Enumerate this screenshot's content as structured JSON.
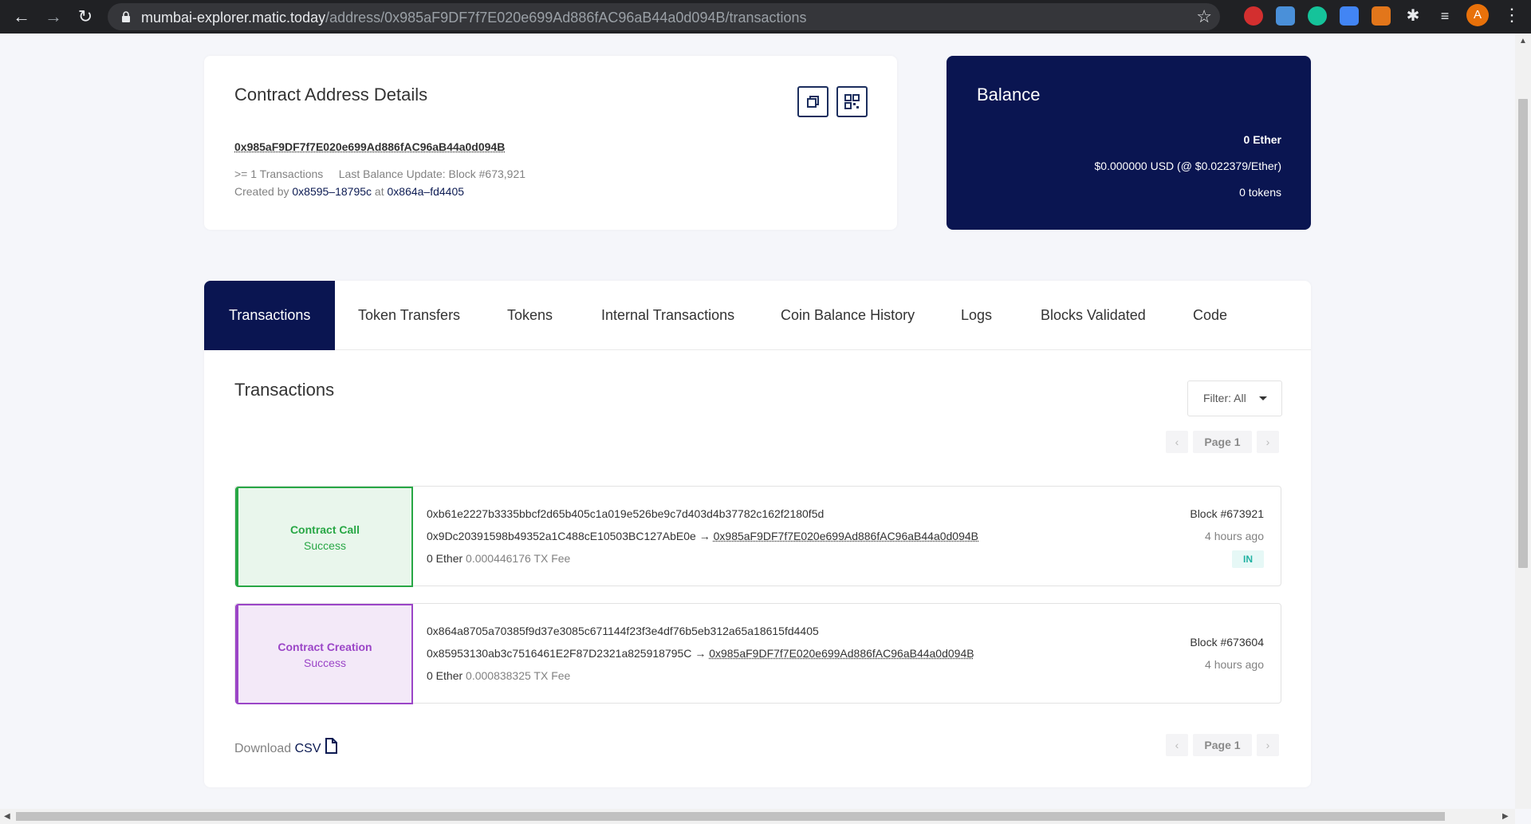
{
  "browser": {
    "url_host": "mumbai-explorer.matic.today",
    "url_path": "/address/0x985aF9DF7f7E020e699Ad886fAC96aB44a0d094B/transactions",
    "profile_initial": "A"
  },
  "details": {
    "title": "Contract Address Details",
    "address": "0x985aF9DF7f7E020e699Ad886fAC96aB44a0d094B",
    "tx_count": ">= 1 Transactions",
    "last_balance": "Last Balance Update: Block #673,921",
    "created_by_label": "Created by",
    "creator": "0x8595–18795c",
    "at_label": "at",
    "creation_tx": "0x864a–fd4405"
  },
  "balance": {
    "title": "Balance",
    "ether": "0 Ether",
    "usd": "$0.000000 USD (@ $0.022379/Ether)",
    "tokens": "0 tokens"
  },
  "tabs": [
    {
      "label": "Transactions"
    },
    {
      "label": "Token Transfers"
    },
    {
      "label": "Tokens"
    },
    {
      "label": "Internal Transactions"
    },
    {
      "label": "Coin Balance History"
    },
    {
      "label": "Logs"
    },
    {
      "label": "Blocks Validated"
    },
    {
      "label": "Code"
    }
  ],
  "transactions_section": {
    "title": "Transactions",
    "filter_label": "Filter: All",
    "page_label": "Page 1",
    "download_label": "Download",
    "csv_label": "CSV"
  },
  "transactions": [
    {
      "type": "Contract Call",
      "status": "Success",
      "hash": "0xb61e2227b3335bbcf2d65b405c1a019e526be9c7d403d4b37782c162f2180f5d",
      "from": "0x9Dc20391598b49352a1C488cE10503BC127AbE0e",
      "arrow": "→",
      "to": "0x985aF9DF7f7E020e699Ad886fAC96aB44a0d094B",
      "value": "0 Ether",
      "fee": "0.000446176 TX Fee",
      "block": "Block #673921",
      "time": "4 hours ago",
      "direction": "IN",
      "accent": "#28a745",
      "tint": "#e9f6ec"
    },
    {
      "type": "Contract Creation",
      "status": "Success",
      "hash": "0x864a8705a70385f9d37e3085c671144f23f3e4df76b5eb312a65a18615fd4405",
      "from": "0x85953130ab3c7516461E2F87D2321a825918795C",
      "arrow": "→",
      "to": "0x985aF9DF7f7E020e699Ad886fAC96aB44a0d094B",
      "value": "0 Ether",
      "fee": "0.000838325 TX Fee",
      "block": "Block #673604",
      "time": "4 hours ago",
      "direction": "",
      "accent": "#9b45c7",
      "tint": "#f3e9f8"
    }
  ]
}
